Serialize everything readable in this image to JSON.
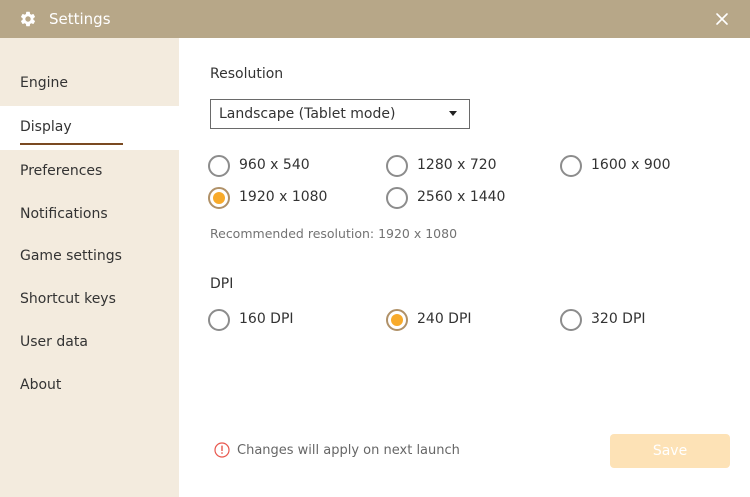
{
  "window": {
    "title": "Settings",
    "title_icon": "gear-icon",
    "close_icon": "close-icon"
  },
  "sidebar": {
    "items": [
      {
        "label": "Engine",
        "active": false
      },
      {
        "label": "Display",
        "active": true
      },
      {
        "label": "Preferences",
        "active": false
      },
      {
        "label": "Notifications",
        "active": false
      },
      {
        "label": "Game settings",
        "active": false
      },
      {
        "label": "Shortcut keys",
        "active": false
      },
      {
        "label": "User data",
        "active": false
      },
      {
        "label": "About",
        "active": false
      }
    ]
  },
  "resolution": {
    "title": "Resolution",
    "mode_selected": "Landscape (Tablet mode)",
    "options": [
      {
        "label": "960 x 540",
        "checked": false
      },
      {
        "label": "1280 x 720",
        "checked": false
      },
      {
        "label": "1600 x 900",
        "checked": false
      },
      {
        "label": "1920 x 1080",
        "checked": true
      },
      {
        "label": "2560 x 1440",
        "checked": false
      }
    ],
    "recommended": "Recommended resolution: 1920 x 1080"
  },
  "dpi": {
    "title": "DPI",
    "options": [
      {
        "label": "160 DPI",
        "checked": false
      },
      {
        "label": "240 DPI",
        "checked": true
      },
      {
        "label": "320 DPI",
        "checked": false
      }
    ]
  },
  "footer": {
    "note": "Changes will apply on next launch",
    "info_icon": "info-icon",
    "save_label": "Save",
    "save_enabled": false
  },
  "colors": {
    "titlebar": "#b7a788",
    "sidebar_bg": "#f3ebde",
    "accent": "#f8aa2a",
    "active_underline": "#7a4a22",
    "save_button_disabled": "#fde2b6"
  }
}
